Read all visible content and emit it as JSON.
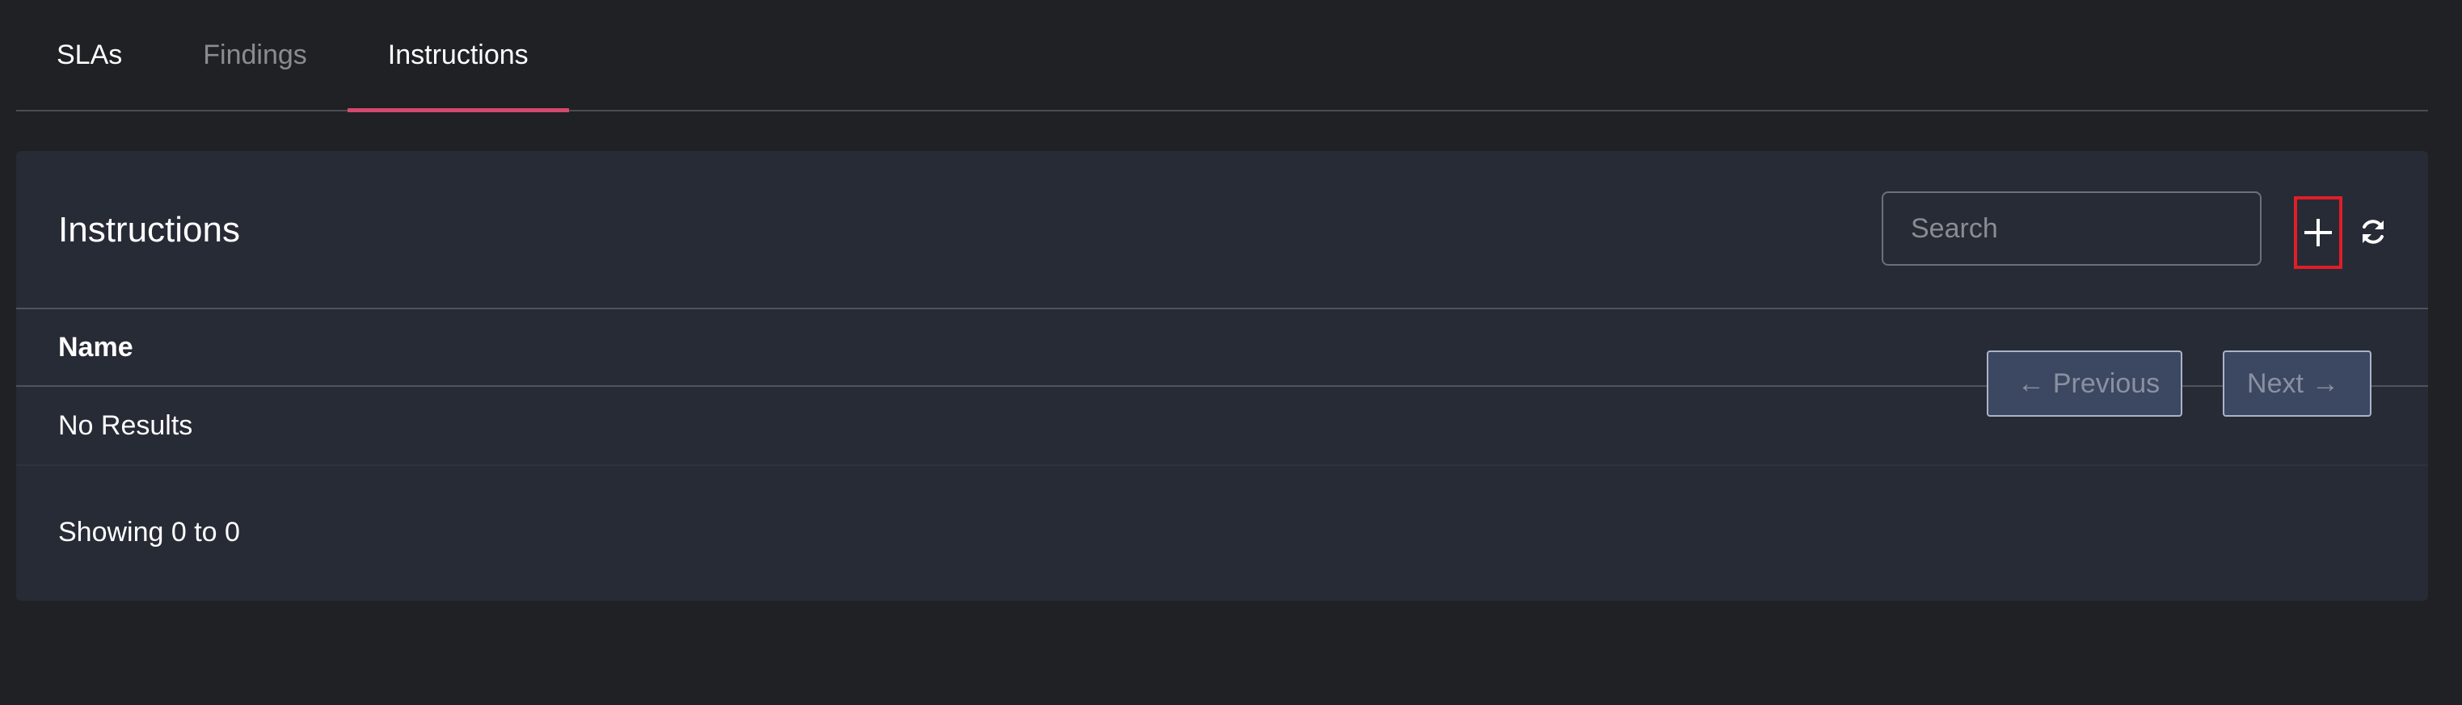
{
  "tabs": [
    {
      "label": "SLAs",
      "active": false
    },
    {
      "label": "Findings",
      "active": false
    },
    {
      "label": "Instructions",
      "active": true
    }
  ],
  "card": {
    "title": "Instructions",
    "search_placeholder": "Search",
    "add_icon": "plus-icon",
    "refresh_icon": "refresh-icon"
  },
  "table": {
    "columns": [
      "Name"
    ],
    "empty_text": "No Results"
  },
  "footer": {
    "showing_text": "Showing 0 to 0",
    "previous_label": "Previous",
    "next_label": "Next",
    "previous_arrow": "←",
    "next_arrow": "→"
  },
  "colors": {
    "background": "#202124",
    "card": "#272b35",
    "active_tab_underline": "#d6496f",
    "highlight_box": "#e01e28"
  }
}
